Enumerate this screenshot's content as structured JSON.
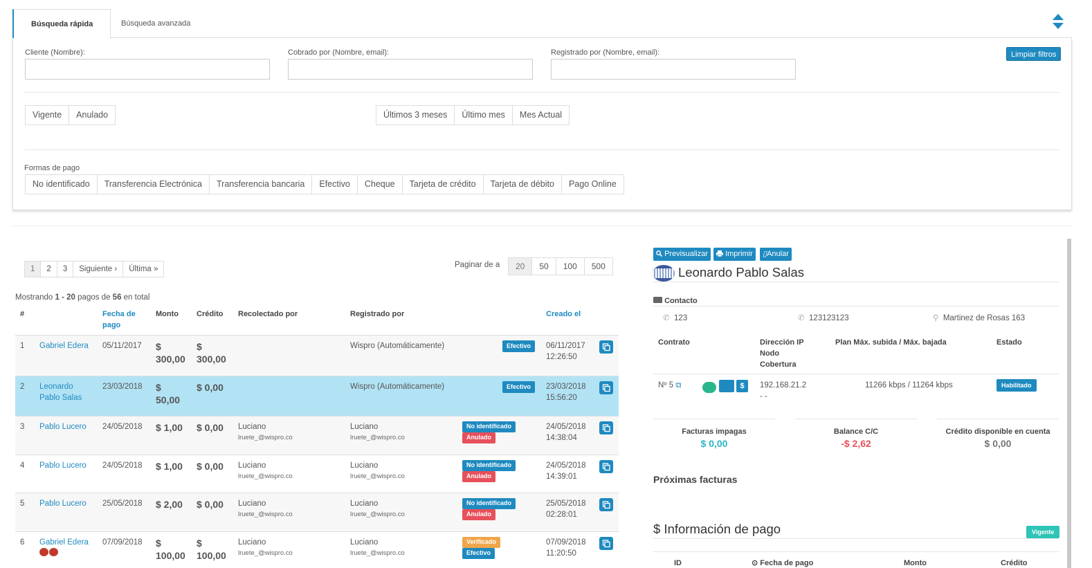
{
  "search": {
    "tabs": [
      "Búsqueda rápida",
      "Búsqueda avanzada"
    ],
    "fields": {
      "cliente_label": "Cliente (Nombre):",
      "cobrado_label": "Cobrado por (Nombre, email):",
      "registrado_label": "Registrado por (Nombre, email):",
      "cliente_value": "",
      "cobrado_value": "",
      "registrado_value": ""
    },
    "clear_filters": "Limpiar filtros",
    "state_filters": [
      "Vigente",
      "Anulado"
    ],
    "period_filters": [
      "Últimos 3 meses",
      "Último mes",
      "Mes Actual"
    ],
    "payment_methods_label": "Formas de pago",
    "payment_methods": [
      "No identificado",
      "Transferencia Electrónica",
      "Transferencia bancaria",
      "Efectivo",
      "Cheque",
      "Tarjeta de crédito",
      "Tarjeta de débito",
      "Pago Online"
    ]
  },
  "pagination": {
    "pages": [
      "1",
      "2",
      "3",
      "Siguiente ›",
      "Última »"
    ],
    "per_page_label": "Paginar de a",
    "per_page": [
      "20",
      "50",
      "100",
      "500"
    ],
    "summary_prefix": "Mostrando ",
    "summary_range": "1 - 20",
    "summary_mid": " pagos de ",
    "summary_total": "56",
    "summary_suffix": " en total"
  },
  "table": {
    "headers": {
      "num": "#",
      "fecha_1": "Fecha de",
      "fecha_2": "pago",
      "monto": "Monto",
      "credito": "Crédito",
      "recolectado": "Recolectado por",
      "registrado": "Registrado por",
      "creado": "Creado el"
    },
    "rows": [
      {
        "num": "1",
        "client_1": "Gabriel Edera",
        "client_2": "",
        "fecha": "05/11/2017",
        "monto_1": "$",
        "monto_2": "300,00",
        "credito_1": "$",
        "credito_2": "300,00",
        "rec_name": "",
        "rec_email": "",
        "reg_name": "Wispro (Automáticamente)",
        "reg_email": "",
        "badge_1": "Efectivo",
        "badge_2": "",
        "created_date": "06/11/2017",
        "created_time": "12:26:50"
      },
      {
        "num": "2",
        "client_1": "Leonardo",
        "client_2": "Pablo Salas",
        "fecha": "23/03/2018",
        "monto_1": "$",
        "monto_2": "50,00",
        "credito_1": "$ 0,00",
        "credito_2": "",
        "rec_name": "",
        "rec_email": "",
        "reg_name": "Wispro (Automáticamente)",
        "reg_email": "",
        "badge_1": "Efectivo",
        "badge_2": "",
        "created_date": "23/03/2018",
        "created_time": "15:56:20"
      },
      {
        "num": "3",
        "client_1": "Pablo Lucero",
        "client_2": "",
        "fecha": "24/05/2018",
        "monto_1": "$ 1,00",
        "monto_2": "",
        "credito_1": "$ 0,00",
        "credito_2": "",
        "rec_name": "Luciano",
        "rec_email": "lruete_@wispro.co",
        "reg_name": "Luciano",
        "reg_email": "lruete_@wispro.co",
        "badge_1": "No identificado",
        "badge_2": "Anulado",
        "created_date": "24/05/2018",
        "created_time": "14:38:04"
      },
      {
        "num": "4",
        "client_1": "Pablo Lucero",
        "client_2": "",
        "fecha": "24/05/2018",
        "monto_1": "$ 1,00",
        "monto_2": "",
        "credito_1": "$ 0,00",
        "credito_2": "",
        "rec_name": "Luciano",
        "rec_email": "lruete_@wispro.co",
        "reg_name": "Luciano",
        "reg_email": "lruete_@wispro.co",
        "badge_1": "No identificado",
        "badge_2": "Anulado",
        "created_date": "24/05/2018",
        "created_time": "14:39:01"
      },
      {
        "num": "5",
        "client_1": "Pablo Lucero",
        "client_2": "",
        "fecha": "25/05/2018",
        "monto_1": "$ 2,00",
        "monto_2": "",
        "credito_1": "$ 0,00",
        "credito_2": "",
        "rec_name": "Luciano",
        "rec_email": "lruete_@wispro.co",
        "reg_name": "Luciano",
        "reg_email": "lruete_@wispro.co",
        "badge_1": "No identificado",
        "badge_2": "Anulado",
        "created_date": "25/05/2018",
        "created_time": "02:28:01"
      },
      {
        "num": "6",
        "client_1": "Gabriel Edera",
        "client_2": "",
        "fecha": "07/09/2018",
        "monto_1": "$",
        "monto_2": "100,00",
        "credito_1": "$",
        "credito_2": "100,00",
        "rec_name": "Luciano",
        "rec_email": "lruete_@wispro.co",
        "reg_name": "Luciano",
        "reg_email": "lruete_@wispro.co",
        "badge_1": "Verificado",
        "badge_2": "Efectivo",
        "created_date": "07/09/2018",
        "created_time": "11:20:50"
      }
    ]
  },
  "detail": {
    "actions": [
      "Previsualizar",
      "Imprimir",
      "Anular"
    ],
    "client_name": "Leonardo Pablo Salas",
    "contact_label": "Contacto",
    "phone_1": "123",
    "phone_2": "123123123",
    "address": "Martinez de Rosas 163",
    "contract_headers": {
      "contrato": "Contrato",
      "ip_1": "Dirección IP",
      "ip_2": "Nodo",
      "ip_3": "Cobertura",
      "plan": "Plan Máx. subida / Máx. bajada",
      "estado": "Estado"
    },
    "contract": {
      "number": "Nº 5",
      "ip": "192.168.21.2",
      "node": "- -",
      "plan": "11266 kbps / 11264 kbps",
      "status": "Habilitado"
    },
    "stats": [
      {
        "label": "Facturas impagas",
        "value": "$ 0,00",
        "color": "#2ab6c4"
      },
      {
        "label": "Balance C/C",
        "value": "-$ 2,62",
        "color": "#e8505b"
      },
      {
        "label": "Crédito disponible en cuenta",
        "value": "$ 0,00",
        "color": "#777777"
      }
    ],
    "next_invoices": "Próximas facturas",
    "payment_info": "$ Información de pago",
    "payment_status": "Vigente",
    "bottom_headers": [
      "ID",
      "Fecha de pago",
      "Monto",
      "Crédito"
    ]
  }
}
